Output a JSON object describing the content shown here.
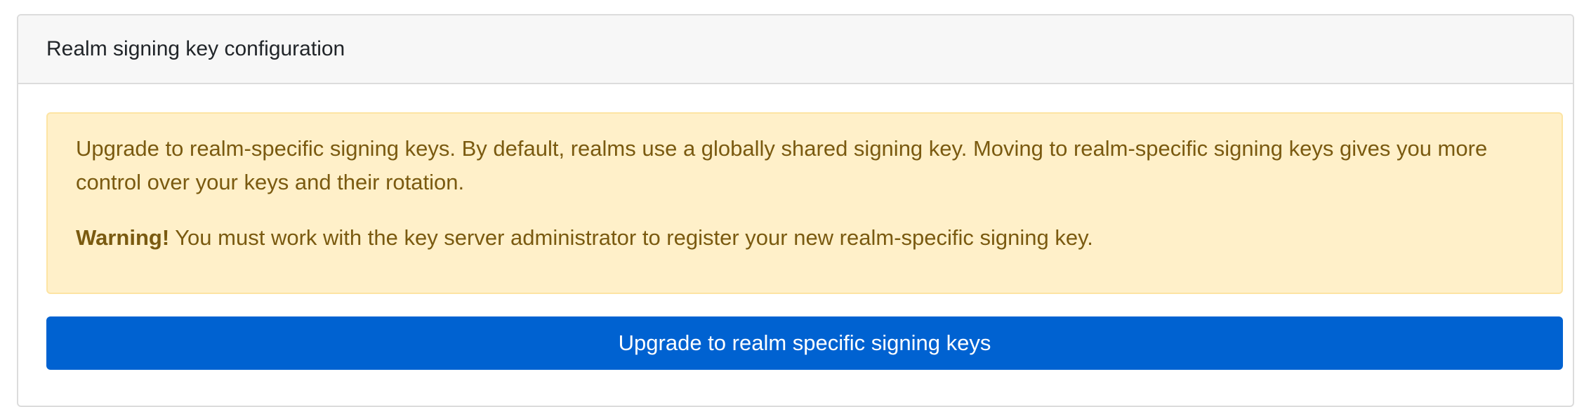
{
  "card": {
    "title": "Realm signing key configuration"
  },
  "alert": {
    "message": "Upgrade to realm-specific signing keys. By default, realms use a globally shared signing key. Moving to realm-specific signing keys gives you more control over your keys and their rotation.",
    "warning_label": "Warning!",
    "warning_text": " You must work with the key server administrator to register your new realm-specific signing key."
  },
  "actions": {
    "upgrade_button_label": "Upgrade to realm specific signing keys"
  }
}
